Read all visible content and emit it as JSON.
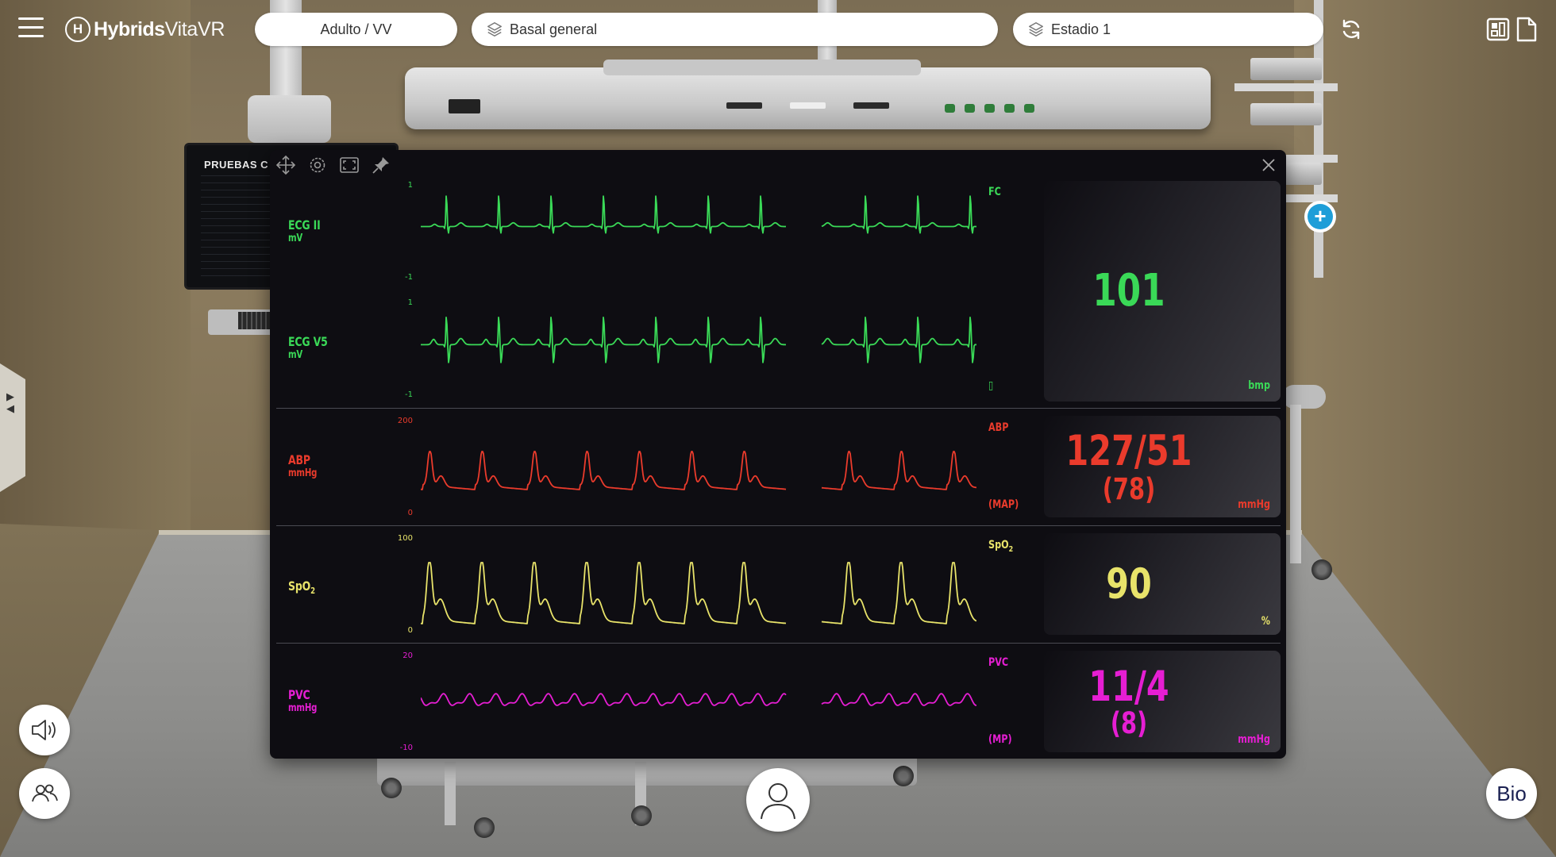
{
  "app": {
    "logo_bold": "Hybrids",
    "logo_light": "VitaVR",
    "logo_mark": "H"
  },
  "topbar": {
    "patient_type": "Adulto / VV",
    "scenario": "Basal general",
    "stage": "Estadio 1"
  },
  "background_screen": {
    "title": "PRUEBAS C"
  },
  "monitor": {
    "channels": [
      {
        "name": "ECG II",
        "unit": "mV",
        "scale_top": "1",
        "scale_bottom": "-1",
        "color": "#3ad957"
      },
      {
        "name": "ECG V5",
        "unit": "mV",
        "scale_top": "1",
        "scale_bottom": "-1",
        "color": "#3ad957"
      },
      {
        "name": "ABP",
        "unit": "mmHg",
        "scale_top": "200",
        "scale_bottom": "0",
        "color": "#ea3b2c"
      },
      {
        "name": "SpO",
        "sub": "2",
        "unit": "",
        "scale_top": "100",
        "scale_bottom": "0",
        "color": "#e8e36a"
      },
      {
        "name": "PVC",
        "unit": "mmHg",
        "scale_top": "20",
        "scale_bottom": "-10",
        "color": "#e61ed3"
      }
    ],
    "numerics": {
      "fc": {
        "label": "FC",
        "value": "101",
        "unit": "bmp",
        "marker": "▯",
        "color": "#3ad957"
      },
      "abp": {
        "label": "ABP",
        "value": "127/51",
        "sub_value": "(78)",
        "sub_label": "(MAP)",
        "unit": "mmHg",
        "color": "#ea3b2c"
      },
      "spo2": {
        "label": "SpO",
        "label_sub": "2",
        "value": "90",
        "unit": "%",
        "color": "#e8e36a"
      },
      "pvc": {
        "label": "PVC",
        "value": "11/4",
        "sub_value": "(8)",
        "sub_label": "(MP)",
        "unit": "mmHg",
        "color": "#e61ed3"
      }
    }
  },
  "bottom": {
    "bio_label": "Bio"
  },
  "icons": {
    "menu": "hamburger-icon",
    "layers": "layers-icon",
    "refresh": "refresh-icon",
    "layout": "layout-icon",
    "document": "document-icon",
    "move": "move-icon",
    "settings": "gear-icon",
    "fullscreen": "fullscreen-icon",
    "pin": "pin-icon",
    "close": "close-icon",
    "add": "plus-icon",
    "sound": "speaker-icon",
    "users": "users-icon",
    "avatar": "user-icon"
  }
}
